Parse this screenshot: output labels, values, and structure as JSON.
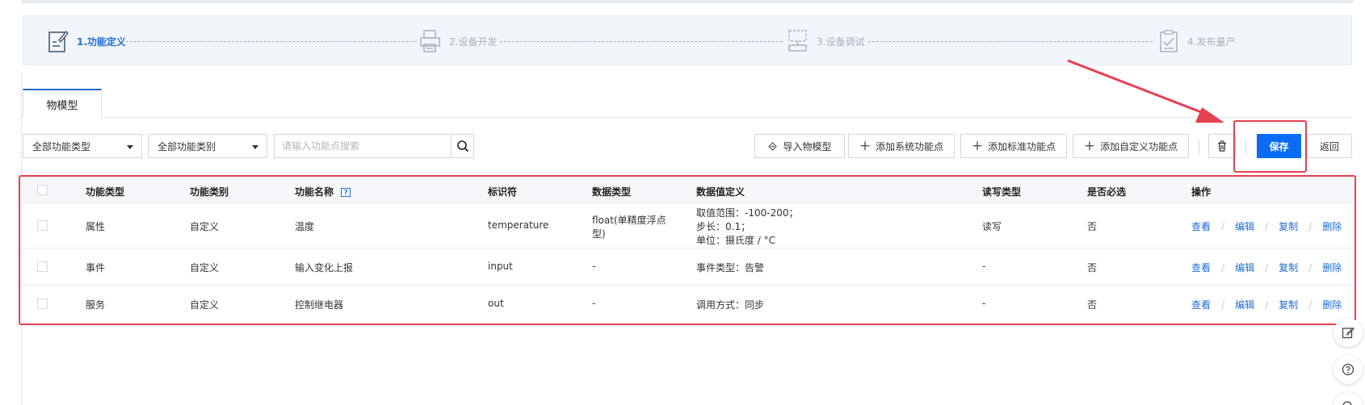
{
  "steps": [
    {
      "label": "1.功能定义",
      "icon": "document-edit-icon",
      "state": "active"
    },
    {
      "label": "2.设备开发",
      "icon": "printer-device-icon",
      "state": "inactive"
    },
    {
      "label": "3.设备调试",
      "icon": "debug-device-icon",
      "state": "inactive"
    },
    {
      "label": "4.发布量产",
      "icon": "clipboard-check-icon",
      "state": "inactive"
    }
  ],
  "tab": {
    "label": "物模型"
  },
  "toolbar": {
    "filter_type": "全部功能类型",
    "filter_category": "全部功能类别",
    "search_placeholder": "请输入功能点搜索",
    "import_label": "导入物模型",
    "add_system_label": "添加系统功能点",
    "add_standard_label": "添加标准功能点",
    "add_custom_label": "添加自定义功能点",
    "save_label": "保存",
    "back_label": "返回"
  },
  "table": {
    "headers": [
      "功能类型",
      "功能类别",
      "功能名称",
      "标识符",
      "数据类型",
      "数据值定义",
      "读写类型",
      "是否必选",
      "操作"
    ],
    "ops": [
      "查看",
      "编辑",
      "复制",
      "删除"
    ],
    "rows": [
      {
        "type": "属性",
        "category": "自定义",
        "name": "温度",
        "identifier": "temperature",
        "data_type_1": "float(单精度浮点",
        "data_type_2": "型)",
        "def_1": "取值范围：-100-200；",
        "def_2": "步长：0.1；",
        "def_3": "单位：摄氏度 / °C",
        "rw": "读写",
        "required": "否"
      },
      {
        "type": "事件",
        "category": "自定义",
        "name": "输入变化上报",
        "identifier": "input",
        "data_type": "-",
        "def": "事件类型：告警",
        "rw": "-",
        "required": "否"
      },
      {
        "type": "服务",
        "category": "自定义",
        "name": "控制继电器",
        "identifier": "out",
        "data_type": "-",
        "def": "调用方式：同步",
        "rw": "-",
        "required": "否"
      }
    ]
  },
  "colors": {
    "accent": "#1f6cd8",
    "save_bg": "#0a6cf5",
    "highlight": "#e6404f"
  }
}
